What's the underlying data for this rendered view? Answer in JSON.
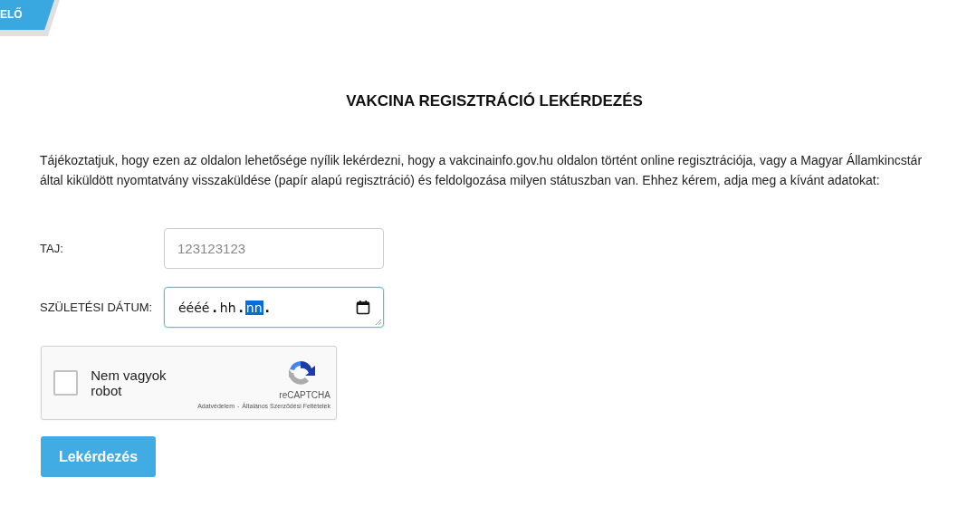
{
  "corner_badge": {
    "label": "ELŐ"
  },
  "title": "VAKCINA REGISZTRÁCIÓ LEKÉRDEZÉS",
  "intro": "Tájékoztatjuk, hogy ezen az oldalon lehetősége nyílik lekérdezni, hogy a vakcinainfo.gov.hu oldalon történt online regisztrációja, vagy a Magyar Államkincstár által kiküldött nyomtatvány visszaküldése (papír alapú regisztráció) és feldolgozása milyen státuszban van. Ehhez kérem, adja meg a kívánt adatokat:",
  "taj": {
    "label": "TAJ:",
    "placeholder": "123123123"
  },
  "birth_date": {
    "label": "SZÜLETÉSI DÁTUM:",
    "focused": true,
    "segments": [
      {
        "text": "éééé",
        "separator": ".",
        "selected": false
      },
      {
        "text": "hh",
        "separator": ".",
        "selected": false
      },
      {
        "text": "nn",
        "separator": ".",
        "selected": true
      }
    ]
  },
  "captcha": {
    "label": "Nem vagyok robot",
    "checked": false,
    "brand": "reCAPTCHA",
    "privacy": "Adatvédelem",
    "separator": "-",
    "terms": "Általános Szerződési Feltételek"
  },
  "submit": "Lekérdezés"
}
